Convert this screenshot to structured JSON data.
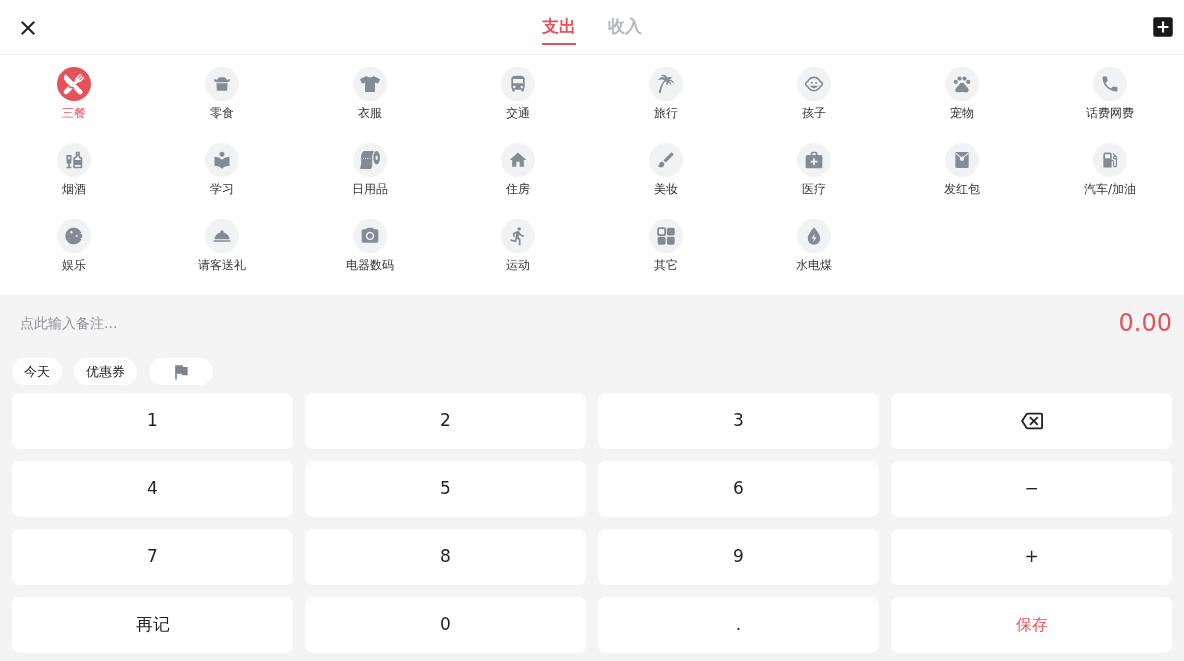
{
  "header": {
    "tabs": [
      {
        "label": "支出",
        "selected": true
      },
      {
        "label": "收入",
        "selected": false
      }
    ]
  },
  "categories": [
    {
      "label": "三餐",
      "selected": true
    },
    {
      "label": "零食",
      "selected": false
    },
    {
      "label": "衣服",
      "selected": false
    },
    {
      "label": "交通",
      "selected": false
    },
    {
      "label": "旅行",
      "selected": false
    },
    {
      "label": "孩子",
      "selected": false
    },
    {
      "label": "宠物",
      "selected": false
    },
    {
      "label": "话费网费",
      "selected": false
    },
    {
      "label": "烟酒",
      "selected": false
    },
    {
      "label": "学习",
      "selected": false
    },
    {
      "label": "日用品",
      "selected": false
    },
    {
      "label": "住房",
      "selected": false
    },
    {
      "label": "美妆",
      "selected": false
    },
    {
      "label": "医疗",
      "selected": false
    },
    {
      "label": "发红包",
      "selected": false
    },
    {
      "label": "汽车/加油",
      "selected": false
    },
    {
      "label": "娱乐",
      "selected": false
    },
    {
      "label": "请客送礼",
      "selected": false
    },
    {
      "label": "电器数码",
      "selected": false
    },
    {
      "label": "运动",
      "selected": false
    },
    {
      "label": "其它",
      "selected": false
    },
    {
      "label": "水电煤",
      "selected": false
    }
  ],
  "remark": {
    "placeholder": "点此输入备注..."
  },
  "amount": "0.00",
  "chips": [
    "今天",
    "优惠券"
  ],
  "keypad": [
    {
      "kind": "key",
      "label": "1"
    },
    {
      "kind": "key",
      "label": "2"
    },
    {
      "kind": "key",
      "label": "3"
    },
    {
      "kind": "backspace"
    },
    {
      "kind": "key",
      "label": "4"
    },
    {
      "kind": "key",
      "label": "5"
    },
    {
      "kind": "key",
      "label": "6"
    },
    {
      "kind": "key",
      "label": "−"
    },
    {
      "kind": "key",
      "label": "7"
    },
    {
      "kind": "key",
      "label": "8"
    },
    {
      "kind": "key",
      "label": "9"
    },
    {
      "kind": "key",
      "label": "+"
    },
    {
      "kind": "key",
      "label": "再记"
    },
    {
      "kind": "key",
      "label": "0"
    },
    {
      "kind": "key",
      "label": "."
    },
    {
      "kind": "save",
      "label": "保存"
    }
  ]
}
